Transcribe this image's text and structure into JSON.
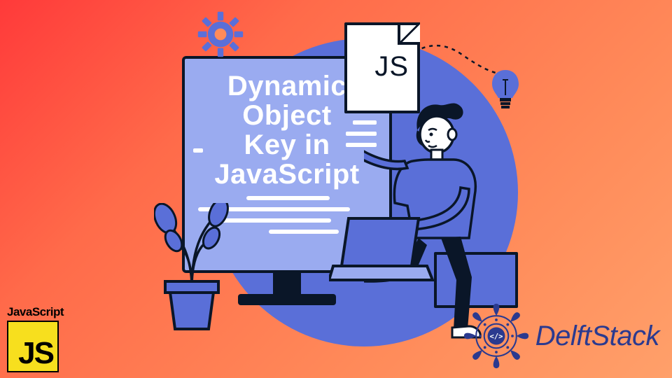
{
  "title_lines": [
    "Dynamic",
    "Object",
    "Key in",
    "JavaScript"
  ],
  "file_label": "JS",
  "js_logo": {
    "top": "JavaScript",
    "letters": "JS"
  },
  "brand": "DelftStack",
  "colors": {
    "accent": "#5a6fd8",
    "dark": "#0a1628",
    "js_yellow": "#f7df1e",
    "brand_blue": "#2b3a8f"
  }
}
